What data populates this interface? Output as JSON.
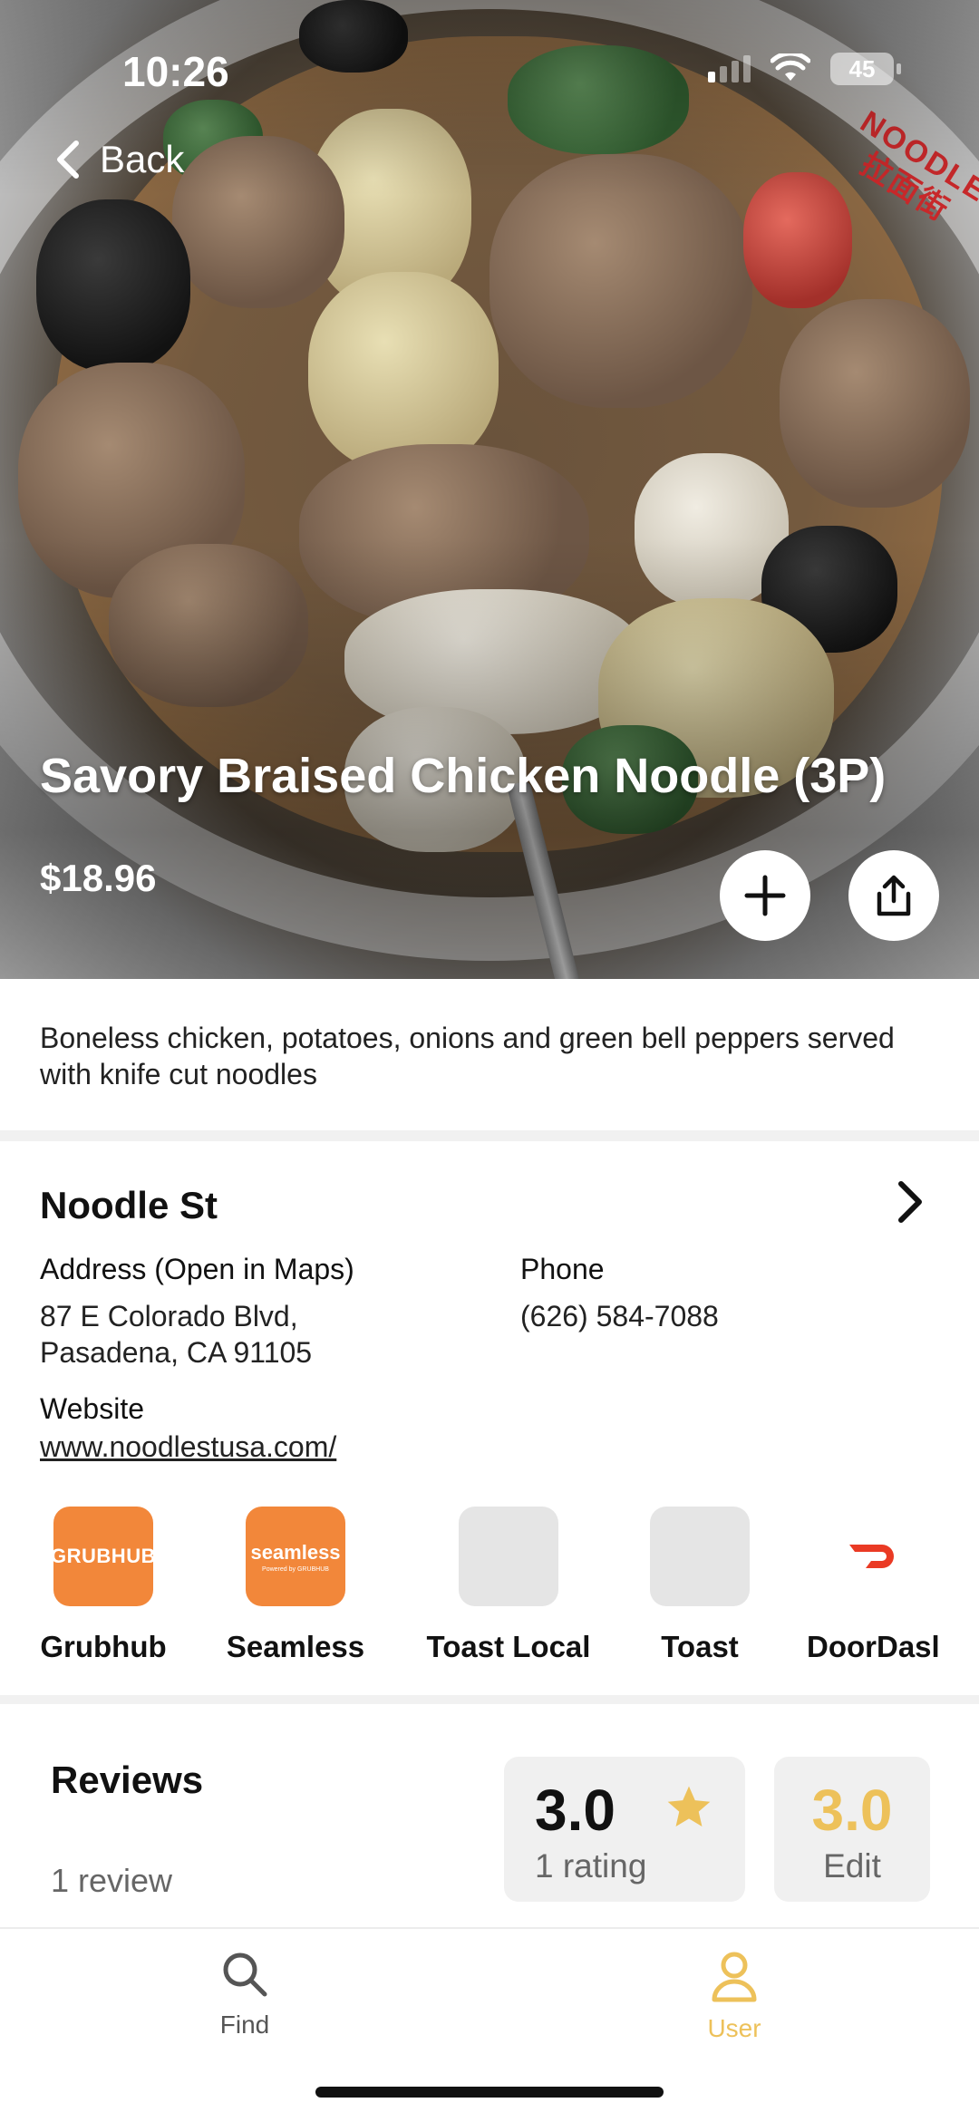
{
  "status_bar": {
    "time": "10:26",
    "battery": "45"
  },
  "nav": {
    "back_label": "Back"
  },
  "hero": {
    "stamp_text": "NOODLE 拉面街"
  },
  "dish": {
    "title": "Savory Braised Chicken Noodle (3P)",
    "price": "$18.96",
    "description": "Boneless chicken, potatoes, onions and green bell peppers served with knife cut noodles"
  },
  "restaurant": {
    "name": "Noodle St",
    "address_label": "Address (Open in Maps)",
    "address_line1": "87 E Colorado Blvd,",
    "address_line2": "Pasadena, CA 91105",
    "phone_label": "Phone",
    "phone": "(626) 584-7088",
    "website_label": "Website",
    "website": "www.noodlestusa.com/"
  },
  "delivery_apps": [
    {
      "name": "Grubhub",
      "logo_text": "GRUBHUB",
      "color": "#f2873a"
    },
    {
      "name": "Seamless",
      "logo_text": "seamless",
      "logo_subtext": "Powered by GRUBHUB",
      "color": "#f2873a"
    },
    {
      "name": "Toast Local"
    },
    {
      "name": "Toast"
    },
    {
      "name": "DoorDasl",
      "color": "#ea3a24"
    }
  ],
  "reviews": {
    "title": "Reviews",
    "count_text": "1 review",
    "average": "3.0",
    "ratings_text": "1 rating",
    "my_rating": "3.0",
    "edit_label": "Edit"
  },
  "tabs": [
    {
      "label": "Find",
      "active": false
    },
    {
      "label": "User",
      "active": true
    }
  ],
  "colors": {
    "accent": "#edc15a",
    "brand_orange": "#f2873a",
    "doordash_red": "#ea3a24"
  }
}
